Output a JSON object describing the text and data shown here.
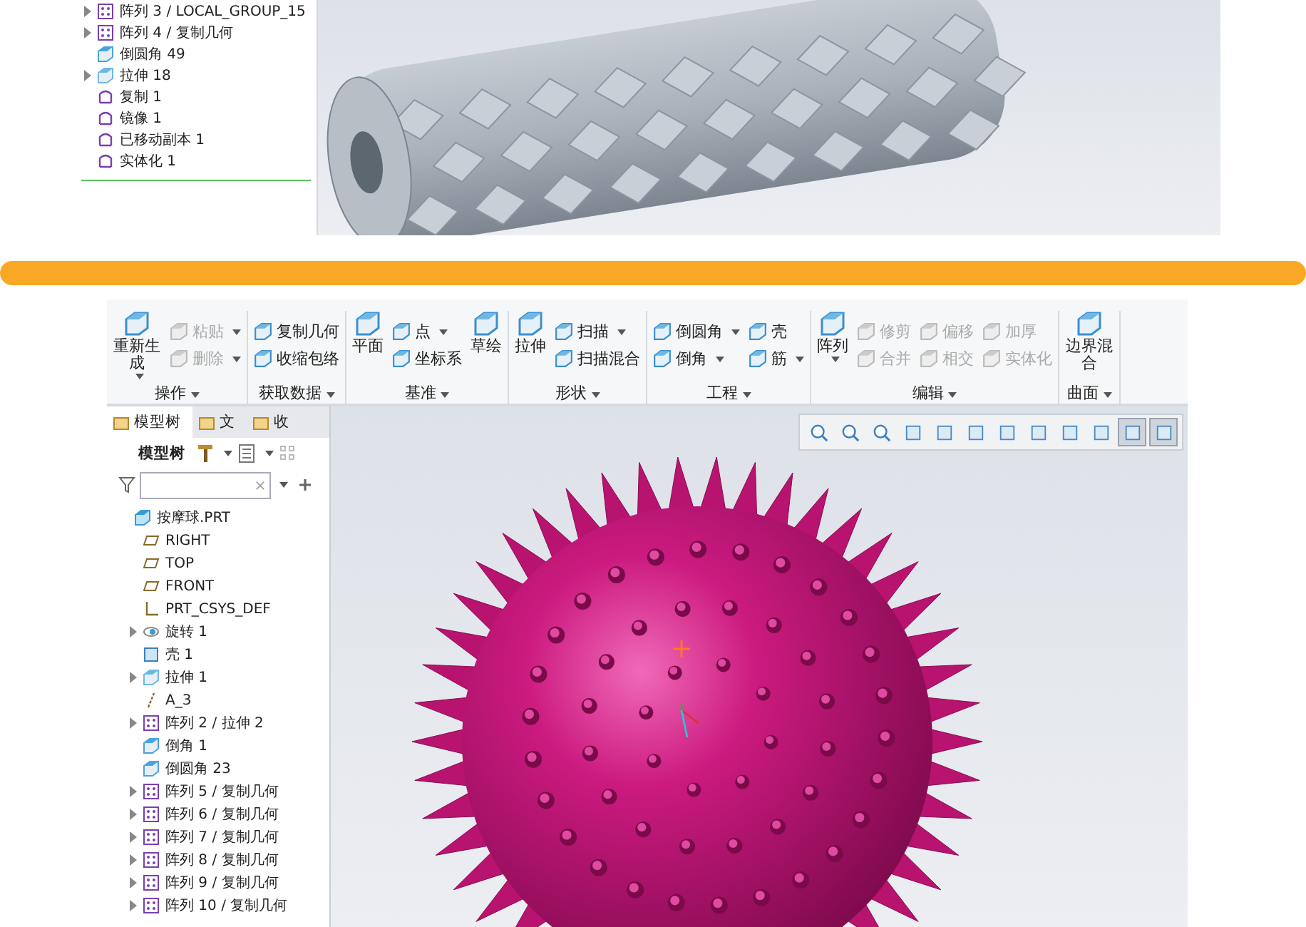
{
  "top_panel": {
    "tree": [
      {
        "label": "阵列 3 / LOCAL_GROUP_15",
        "kind": "pattern",
        "expander": true
      },
      {
        "label": "阵列 4 / 复制几何",
        "kind": "pattern",
        "expander": true
      },
      {
        "label": "倒圆角 49",
        "kind": "round",
        "expander": false
      },
      {
        "label": "拉伸 18",
        "kind": "extrude",
        "expander": true
      },
      {
        "label": "复制 1",
        "kind": "copy",
        "expander": false
      },
      {
        "label": "镜像 1",
        "kind": "mirror",
        "expander": false
      },
      {
        "label": "已移动副本 1",
        "kind": "moved-copy",
        "expander": false
      },
      {
        "label": "实体化 1",
        "kind": "solidify",
        "expander": false
      }
    ]
  },
  "ribbon": {
    "groups": [
      {
        "label": "操作",
        "columns": [
          [
            {
              "label": "重新生成",
              "kind": "large",
              "dropdown": true,
              "disabled": false
            }
          ],
          [
            {
              "label": "粘贴",
              "kind": "small",
              "dropdown": true,
              "disabled": true
            },
            {
              "label": "删除",
              "kind": "small",
              "dropdown": true,
              "disabled": true
            }
          ]
        ]
      },
      {
        "label": "获取数据",
        "columns": [
          [
            {
              "label": "复制几何",
              "kind": "small",
              "dropdown": false,
              "disabled": false
            },
            {
              "label": "收缩包络",
              "kind": "small",
              "dropdown": false,
              "disabled": false
            }
          ]
        ]
      },
      {
        "label": "基准",
        "columns": [
          [
            {
              "label": "平面",
              "kind": "large",
              "dropdown": false,
              "disabled": false
            }
          ],
          [
            {
              "label": "点",
              "kind": "small",
              "dropdown": true,
              "disabled": false
            },
            {
              "label": "坐标系",
              "kind": "small",
              "dropdown": false,
              "disabled": false
            }
          ],
          [
            {
              "label": "草绘",
              "kind": "large",
              "dropdown": false,
              "disabled": false
            }
          ]
        ]
      },
      {
        "label": "形状",
        "columns": [
          [
            {
              "label": "拉伸",
              "kind": "large",
              "dropdown": false,
              "disabled": false
            }
          ],
          [
            {
              "label": "扫描",
              "kind": "small",
              "dropdown": true,
              "disabled": false
            },
            {
              "label": "扫描混合",
              "kind": "small",
              "dropdown": false,
              "disabled": false
            }
          ]
        ]
      },
      {
        "label": "工程",
        "columns": [
          [
            {
              "label": "倒圆角",
              "kind": "small",
              "dropdown": true,
              "disabled": false
            },
            {
              "label": "倒角",
              "kind": "small",
              "dropdown": true,
              "disabled": false
            }
          ],
          [
            {
              "label": "壳",
              "kind": "small",
              "dropdown": false,
              "disabled": false
            },
            {
              "label": "筋",
              "kind": "small",
              "dropdown": true,
              "disabled": false
            }
          ]
        ]
      },
      {
        "label": "编辑",
        "columns": [
          [
            {
              "label": "阵列",
              "kind": "large",
              "dropdown": true,
              "disabled": false
            }
          ],
          [
            {
              "label": "修剪",
              "kind": "small",
              "dropdown": false,
              "disabled": true
            },
            {
              "label": "合并",
              "kind": "small",
              "dropdown": false,
              "disabled": true
            }
          ],
          [
            {
              "label": "偏移",
              "kind": "small",
              "dropdown": false,
              "disabled": true
            },
            {
              "label": "相交",
              "kind": "small",
              "dropdown": false,
              "disabled": true
            }
          ],
          [
            {
              "label": "加厚",
              "kind": "small",
              "dropdown": false,
              "disabled": true
            },
            {
              "label": "实体化",
              "kind": "small",
              "dropdown": false,
              "disabled": true
            }
          ]
        ]
      },
      {
        "label": "曲面",
        "columns": [
          [
            {
              "label": "边界混合",
              "kind": "large",
              "dropdown": false,
              "disabled": false
            }
          ]
        ]
      }
    ]
  },
  "panel_tabs": [
    {
      "label": "模型树",
      "selected": true
    },
    {
      "label": "文",
      "selected": false
    },
    {
      "label": "收",
      "selected": false
    }
  ],
  "tree_toolbar": {
    "title": "模型树"
  },
  "tree": [
    {
      "label": "按摩球.PRT",
      "kind": "part",
      "expander": false,
      "children": [
        {
          "label": "RIGHT",
          "kind": "plane",
          "expander": false
        },
        {
          "label": "TOP",
          "kind": "plane",
          "expander": false
        },
        {
          "label": "FRONT",
          "kind": "plane",
          "expander": false
        },
        {
          "label": "PRT_CSYS_DEF",
          "kind": "csys",
          "expander": false
        },
        {
          "label": "旋转 1",
          "kind": "revolve",
          "expander": true
        },
        {
          "label": "壳 1",
          "kind": "shell",
          "expander": false
        },
        {
          "label": "拉伸 1",
          "kind": "extrude",
          "expander": true
        },
        {
          "label": "A_3",
          "kind": "axis",
          "expander": false
        },
        {
          "label": "阵列 2 / 拉伸 2",
          "kind": "pattern",
          "expander": true
        },
        {
          "label": "倒角 1",
          "kind": "round",
          "expander": false
        },
        {
          "label": "倒圆角 23",
          "kind": "round",
          "expander": false
        },
        {
          "label": "阵列 5 / 复制几何",
          "kind": "pattern",
          "expander": true
        },
        {
          "label": "阵列 6 / 复制几何",
          "kind": "pattern",
          "expander": true
        },
        {
          "label": "阵列 7 / 复制几何",
          "kind": "pattern",
          "expander": true
        },
        {
          "label": "阵列 8 / 复制几何",
          "kind": "pattern",
          "expander": true
        },
        {
          "label": "阵列 9 / 复制几何",
          "kind": "pattern",
          "expander": true
        },
        {
          "label": "阵列 10 / 复制几何",
          "kind": "pattern",
          "expander": true
        }
      ]
    }
  ],
  "view_toolbar": [
    {
      "selected": false
    },
    {
      "selected": false
    },
    {
      "selected": false
    },
    {
      "selected": false
    },
    {
      "selected": false
    },
    {
      "selected": false
    },
    {
      "selected": false
    },
    {
      "selected": false
    },
    {
      "selected": false
    },
    {
      "selected": false
    },
    {
      "selected": true
    },
    {
      "selected": true
    }
  ]
}
